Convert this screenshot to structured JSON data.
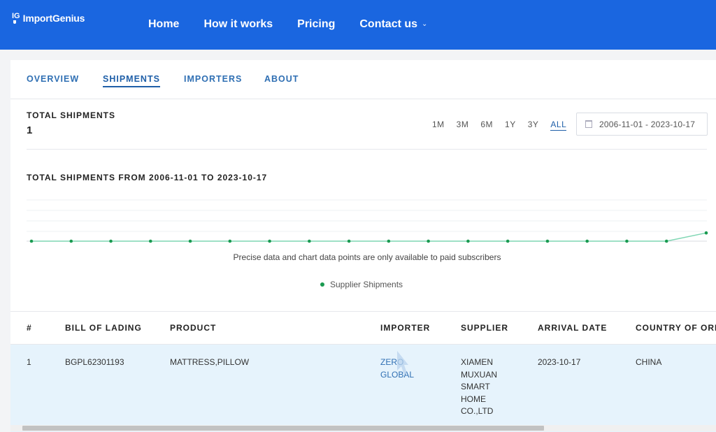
{
  "brand": {
    "mark": "IG",
    "name": "ImportGenius"
  },
  "nav": {
    "items": [
      {
        "label": "Home"
      },
      {
        "label": "How it works"
      },
      {
        "label": "Pricing"
      },
      {
        "label": "Contact us"
      }
    ]
  },
  "tabs": [
    {
      "label": "OVERVIEW"
    },
    {
      "label": "SHIPMENTS"
    },
    {
      "label": "IMPORTERS"
    },
    {
      "label": "ABOUT"
    }
  ],
  "active_tab": "SHIPMENTS",
  "summary": {
    "label": "TOTAL SHIPMENTS",
    "value": "1"
  },
  "ranges": [
    "1M",
    "3M",
    "6M",
    "1Y",
    "3Y",
    "ALL"
  ],
  "active_range": "ALL",
  "date_range": "2006-11-01 - 2023-10-17",
  "chart": {
    "title": "TOTAL SHIPMENTS FROM 2006-11-01 TO 2023-10-17",
    "note": "Precise data and chart data points are only available to paid subscribers",
    "legend": "Supplier Shipments"
  },
  "chart_data": {
    "type": "line",
    "title": "TOTAL SHIPMENTS FROM 2006-11-01 TO 2023-10-17",
    "series": [
      {
        "name": "Supplier Shipments",
        "color": "#1a9a50",
        "values": [
          0,
          0,
          0,
          0,
          0,
          0,
          0,
          0,
          0,
          0,
          0,
          0,
          0,
          0,
          0,
          0,
          0,
          1
        ]
      }
    ],
    "grid": true,
    "legend_position": "bottom"
  },
  "table": {
    "headers": [
      "#",
      "BILL OF LADING",
      "PRODUCT",
      "IMPORTER",
      "SUPPLIER",
      "ARRIVAL DATE",
      "COUNTRY OF ORIGIN"
    ],
    "rows": [
      {
        "num": "1",
        "bill": "BGPL62301193",
        "product": "MATTRESS,PILLOW",
        "importer": "ZERO GLOBAL",
        "supplier": "XIAMEN MUXUAN SMART HOME CO.,LTD",
        "arrival": "2023-10-17",
        "country": "CHINA"
      }
    ]
  },
  "colors": {
    "header": "#1a66e0",
    "accent": "#1f5fa8",
    "row_highlight": "#e6f3fc",
    "series": "#1a9a50"
  }
}
